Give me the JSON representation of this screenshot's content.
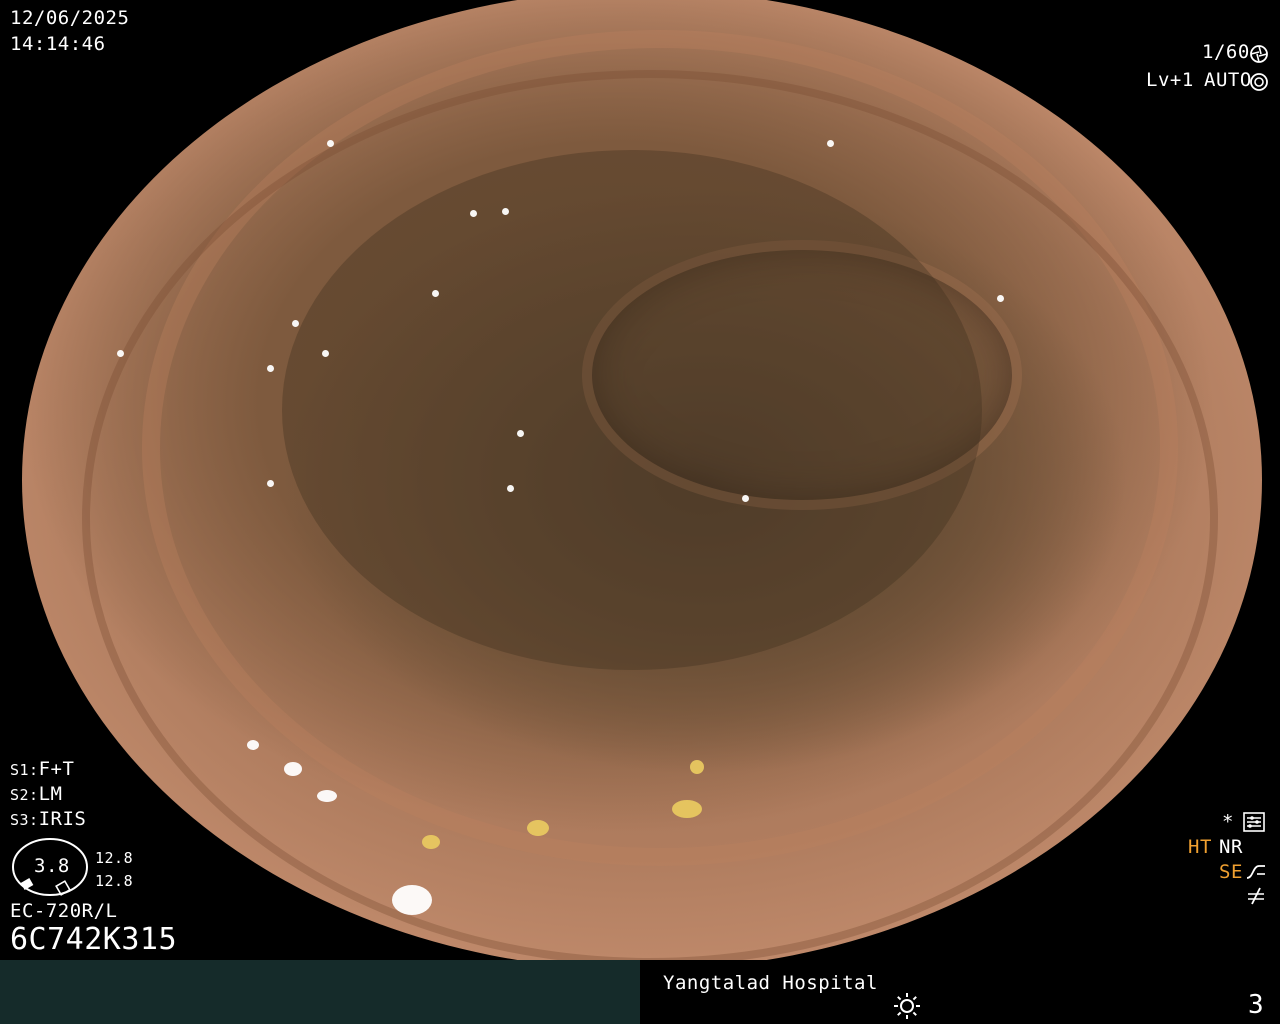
{
  "overlay": {
    "date": "12/06/2025",
    "time": "14:14:46",
    "shutter": "1/60",
    "level": "Lv+1",
    "iris_mode": "AUTO",
    "s1_label": "S1:",
    "s1_value": "F+T",
    "s2_label": "S2:",
    "s2_value": "LM",
    "s3_label": "S3:",
    "s3_value": "IRIS",
    "gauge_value": "3.8",
    "gauge_upper": "12.8",
    "gauge_lower": "12.8",
    "scope_model": "EC-720R/L",
    "serial": "6C742K315",
    "asterisk": "*",
    "ht": "HT",
    "nr": "NR",
    "se": "SE",
    "hospital": "Yangtalad Hospital",
    "counter": "3"
  },
  "icons": {
    "shutter": "aperture-icon",
    "auto": "iris-icon",
    "settings": "settings-panel-icon",
    "se": "enhancement-curve-icon",
    "freeze": "freeze-slash-icon",
    "light": "sun-icon"
  },
  "colors": {
    "accent": "#f0a030",
    "footer": "#152b2a"
  }
}
